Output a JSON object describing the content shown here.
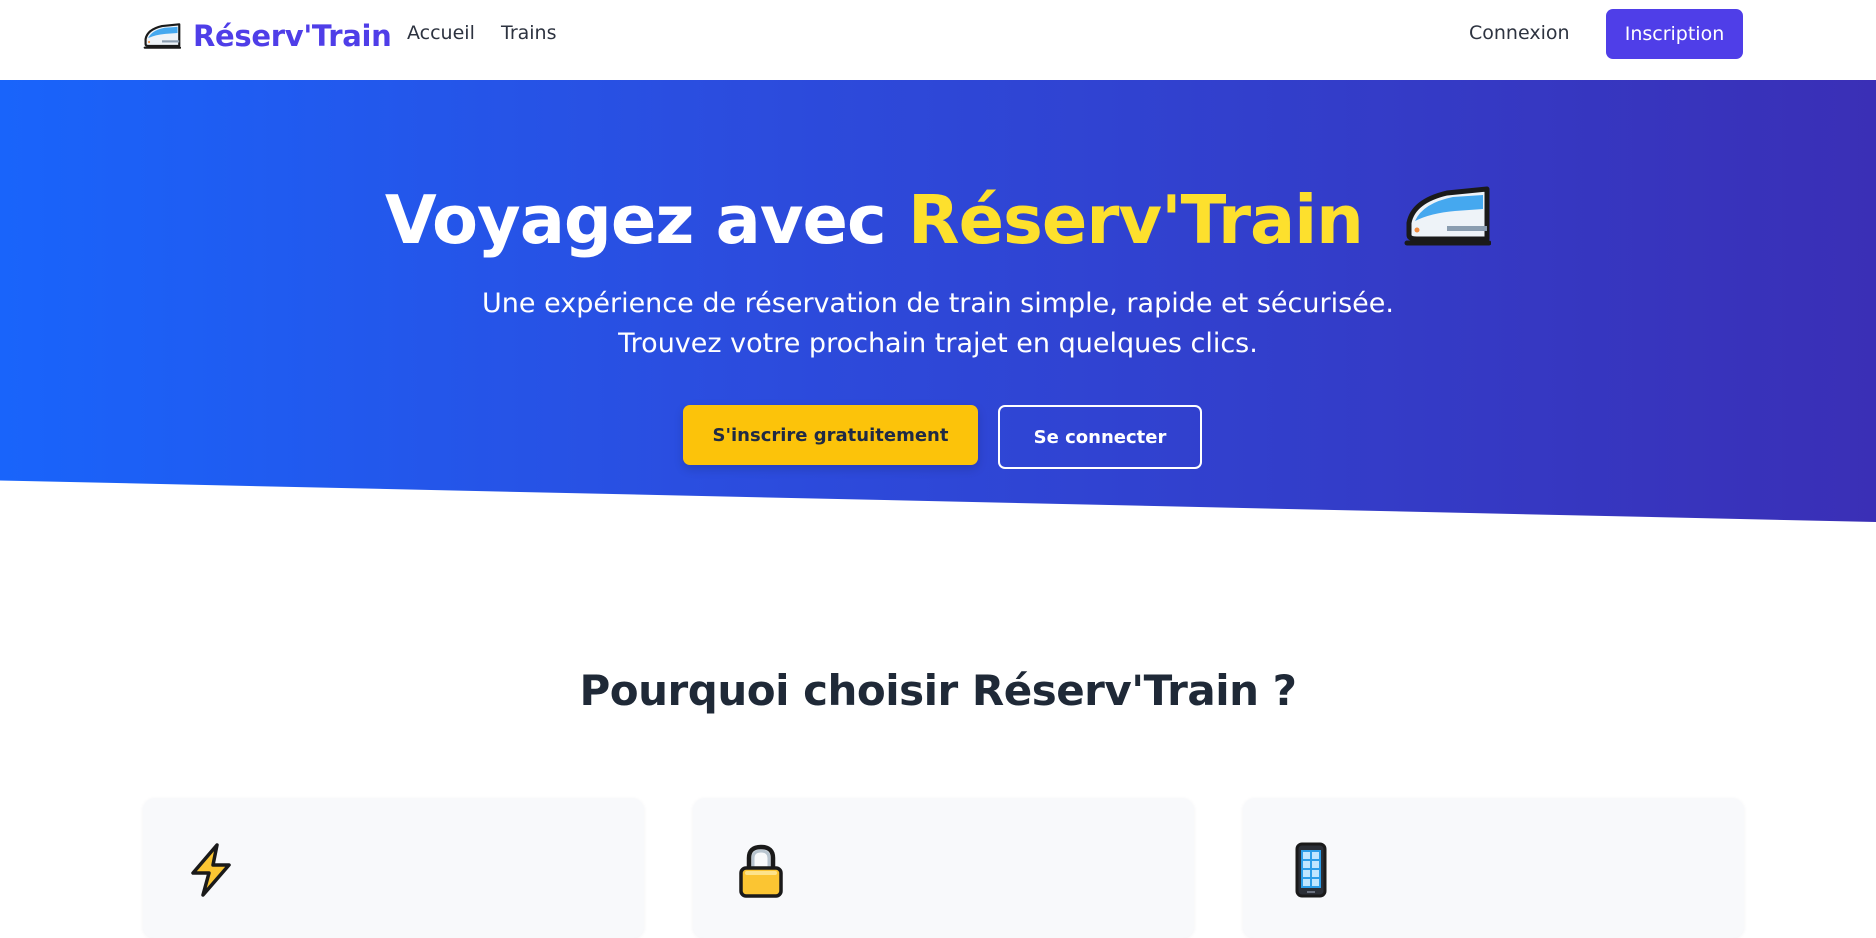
{
  "navbar": {
    "brand_name": "Réserv'Train",
    "brand_icon": "high-speed-train-icon",
    "links": [
      {
        "label": "Accueil"
      },
      {
        "label": "Trains"
      }
    ],
    "login_label": "Connexion",
    "signup_label": "Inscription"
  },
  "hero": {
    "title_prefix": "Voyagez avec ",
    "title_accent": "Réserv'Train",
    "title_icon": "high-speed-train-icon",
    "subtitle_line1": "Une expérience de réservation de train simple, rapide et sécurisée.",
    "subtitle_line2": "Trouvez votre prochain trajet en quelques clics.",
    "primary_cta": "S'inscrire gratuitement",
    "secondary_cta": "Se connecter"
  },
  "features": {
    "title": "Pourquoi choisir Réserv'Train ?",
    "cards": [
      {
        "icon": "lightning-icon"
      },
      {
        "icon": "padlock-icon"
      },
      {
        "icon": "mobile-phone-icon"
      }
    ]
  },
  "colors": {
    "brand": "#4f3ee8",
    "accent_yellow": "#fde02d",
    "cta_yellow": "#fcc30a",
    "hero_gradient_start": "#1964fb",
    "hero_gradient_end": "#3a2fb6",
    "heading_dark": "#1f2937"
  }
}
